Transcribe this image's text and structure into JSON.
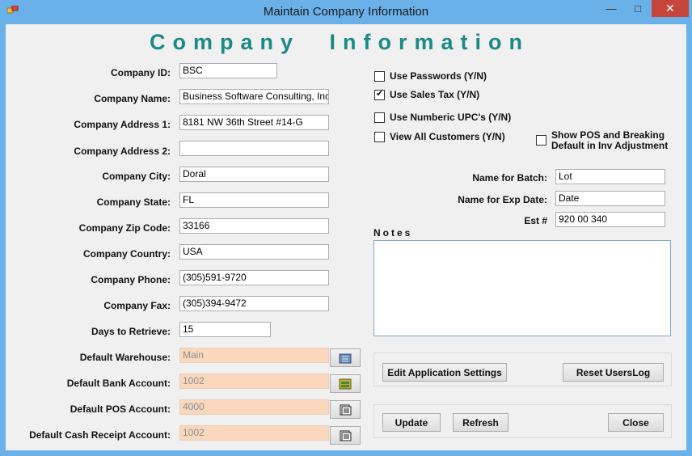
{
  "window": {
    "title": "Maintain Company Information",
    "minimize": "—",
    "maximize": "□",
    "close": "✕"
  },
  "page": {
    "title": "Company Information"
  },
  "fields": [
    {
      "label": "Company ID:",
      "value": "BSC"
    },
    {
      "label": "Company Name:",
      "value": "Business Software Consulting, Inc."
    },
    {
      "label": "Company Address 1:",
      "value": "8181 NW 36th Street #14-G"
    },
    {
      "label": "Company Address 2:",
      "value": ""
    },
    {
      "label": "Company City:",
      "value": "Doral"
    },
    {
      "label": "Company State:",
      "value": "FL"
    },
    {
      "label": "Company Zip Code:",
      "value": "33166"
    },
    {
      "label": "Company Country:",
      "value": "USA"
    },
    {
      "label": "Company Phone:",
      "value": "(305)591-9720"
    },
    {
      "label": "Company Fax:",
      "value": "(305)394-9472"
    },
    {
      "label": "Days to Retrieve:",
      "value": "15"
    }
  ],
  "accounts": [
    {
      "label": "Default Warehouse:",
      "value": "Main",
      "icon": "warehouse-icon"
    },
    {
      "label": "Default Bank Account:",
      "value": "1002",
      "icon": "bank-icon"
    },
    {
      "label": "Default POS Account:",
      "value": "4000",
      "icon": "ledger-icon"
    },
    {
      "label": "Default Cash Receipt Account:",
      "value": "1002",
      "icon": "ledger-icon"
    }
  ],
  "options": [
    {
      "label": "Use Passwords (Y/N)",
      "checked": false
    },
    {
      "label": "Use Sales Tax  (Y/N)",
      "checked": true
    },
    {
      "label": "Use Numberic UPC's (Y/N)",
      "checked": false
    },
    {
      "label": "View All Customers (Y/N)",
      "checked": false
    },
    {
      "label_line1": "Show POS and Breaking",
      "label_line2": "Default in Inv Adjustment",
      "checked": false
    }
  ],
  "names": [
    {
      "label": "Name for Batch:",
      "value": "Lot"
    },
    {
      "label": "Name for Exp Date:",
      "value": "Date"
    },
    {
      "label": "Est #",
      "value": "920 00 340"
    }
  ],
  "notes": {
    "label": "Notes",
    "value": ""
  },
  "buttons": {
    "edit_settings": "Edit Application Settings",
    "reset_log": "Reset UsersLog",
    "update": "Update",
    "refresh": "Refresh",
    "close": "Close"
  }
}
